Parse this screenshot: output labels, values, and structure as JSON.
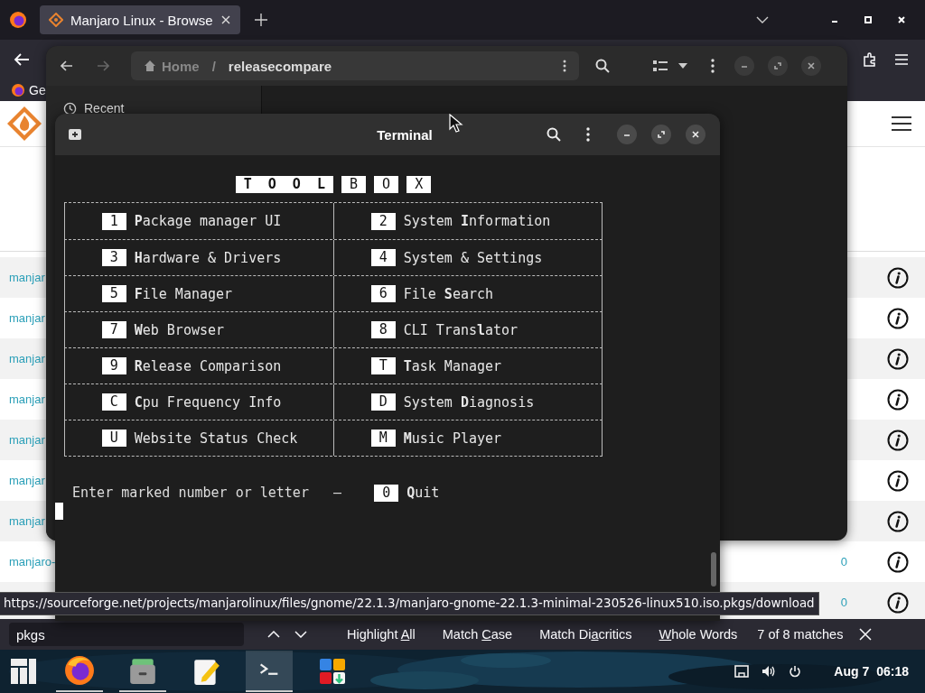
{
  "browser": {
    "tab": {
      "title": "Manjaro Linux - Browse",
      "selected": true
    },
    "bookmark": "Ge",
    "rows": [
      {
        "name": "manjar"
      },
      {
        "name": "manjar"
      },
      {
        "name": "manjar"
      },
      {
        "name": "manjar"
      },
      {
        "name": "manjar"
      },
      {
        "name": "manjar"
      },
      {
        "name": "manjar"
      },
      {
        "name": "manjaro-",
        "count": "0"
      },
      {
        "count": "0"
      }
    ],
    "status_url": "https://sourceforge.net/projects/manjarolinux/files/gnome/22.1.3/manjaro-gnome-22.1.3-minimal-230526-linux510.iso.pkgs/download",
    "find_bar": {
      "value": "pkgs",
      "options": [
        {
          "before": "Highlight ",
          "key": "A",
          "after": "ll"
        },
        {
          "before": "Match ",
          "key": "C",
          "after": "ase"
        },
        {
          "before": "Match Di",
          "key": "a",
          "after": "critics"
        },
        {
          "key": "W",
          "after": "hole Words"
        }
      ],
      "matches": "7 of 8 matches"
    }
  },
  "file_manager": {
    "path": [
      "Home",
      "releasecompare"
    ],
    "separator": "/",
    "sidebar": [
      {
        "label": "Recent"
      }
    ]
  },
  "terminal": {
    "title": "Terminal",
    "banner": [
      "T  O  O  L",
      "B",
      "O",
      "X"
    ],
    "menu": [
      {
        "left": {
          "key": "1",
          "label": "**P**ackage manager UI"
        },
        "right": {
          "key": "2",
          "label": "System **I**nformation"
        }
      },
      {
        "left": {
          "key": "3",
          "label": "**H**ardware & Drivers"
        },
        "right": {
          "key": "4",
          "label": "System & Settings"
        }
      },
      {
        "left": {
          "key": "5",
          "label": "**F**ile Manager"
        },
        "right": {
          "key": "6",
          "label": "File **S**earch"
        }
      },
      {
        "left": {
          "key": "7",
          "label": "**W**eb Browser"
        },
        "right": {
          "key": "8",
          "label": "CLI Trans**l**ator"
        }
      },
      {
        "left": {
          "key": "9",
          "label": "**R**elease Comparison"
        },
        "right": {
          "key": "T",
          "label": "**T**ask Manager"
        }
      },
      {
        "left": {
          "key": "C",
          "label": "**C**pu Frequency Info"
        },
        "right": {
          "key": "D",
          "label": "System **D**iagnosis"
        }
      },
      {
        "left": {
          "key": "U",
          "label": "Website Status Check"
        },
        "right": {
          "key": "M",
          "label": "**M**usic Player"
        }
      }
    ],
    "prompt": "Enter marked number or letter",
    "separator": "–",
    "quit": {
      "key": "0",
      "label": "**Q**uit"
    }
  },
  "taskbar": {
    "apps": [
      {
        "kind": "menu",
        "running": false,
        "selected": false
      },
      {
        "kind": "firefox",
        "running": true,
        "selected": false
      },
      {
        "kind": "files",
        "running": true,
        "selected": false
      },
      {
        "kind": "notes",
        "running": false,
        "selected": false
      },
      {
        "kind": "terminal",
        "running": true,
        "selected": true
      },
      {
        "kind": "software",
        "running": false,
        "selected": false
      }
    ],
    "date": "Aug 7",
    "time": "06:18"
  }
}
